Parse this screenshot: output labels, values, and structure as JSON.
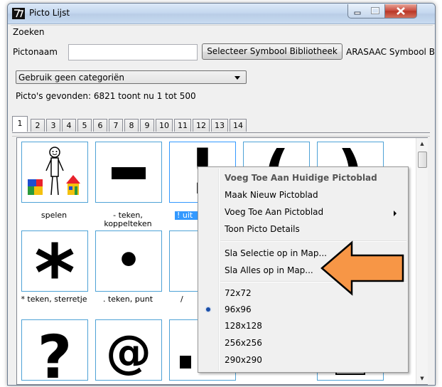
{
  "window": {
    "title": "Picto Lijst",
    "controls": {
      "minimize": "–",
      "maximize": "□",
      "close": "✕"
    }
  },
  "search": {
    "group_label": "Zoeken",
    "name_label": "Pictonaam",
    "name_value": "",
    "select_library_button": "Selecteer Symbool Bibliotheek",
    "library_label": "ARASAAC Symbool B",
    "category_select": "Gebruik geen categoriën",
    "found_text": "Picto's gevonden: 6821 toont nu 1 tot 500"
  },
  "tabs": [
    "1",
    "2",
    "3",
    "4",
    "5",
    "6",
    "7",
    "8",
    "9",
    "10",
    "11",
    "12",
    "13",
    "14"
  ],
  "active_tab": "1",
  "pictos": [
    {
      "symbol": "",
      "caption": "spelen"
    },
    {
      "symbol": "",
      "caption": "- teken, koppelteken"
    },
    {
      "symbol": "!",
      "caption": "! uit"
    },
    {
      "symbol": "(",
      "caption": ""
    },
    {
      "symbol": ")",
      "caption": ""
    },
    {
      "symbol": "*",
      "caption": "* teken, sterretje"
    },
    {
      "symbol": "•",
      "caption": ". teken, punt"
    },
    {
      "symbol": "/",
      "caption": "/"
    },
    {
      "symbol": "?",
      "caption": ""
    },
    {
      "symbol": "@",
      "caption": ""
    },
    {
      "symbol": "·",
      "caption": ""
    }
  ],
  "context_menu": {
    "items": [
      {
        "label": "Voeg Toe Aan Huidige Pictoblad",
        "bold": true
      },
      {
        "label": "Maak Nieuw Pictoblad"
      },
      {
        "label": "Voeg Toe Aan Pictoblad",
        "submenu": true
      },
      {
        "label": "Toon Picto Details"
      },
      {
        "label": "Sla Selectie op in Map..."
      },
      {
        "label": "Sla Alles op in Map..."
      },
      {
        "label": "72x72"
      },
      {
        "label": "96x96",
        "checked": true
      },
      {
        "label": "128x128"
      },
      {
        "label": "256x256"
      },
      {
        "label": "290x290"
      }
    ]
  },
  "colors": {
    "cell_border": "#4ea2d6",
    "selection": "#3399ff",
    "callout_fill": "#f79646",
    "callout_border": "#000000"
  }
}
